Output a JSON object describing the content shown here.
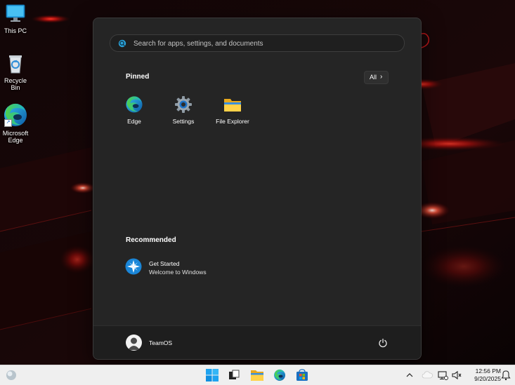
{
  "desktop": {
    "icons": [
      {
        "label": "This PC",
        "icon": "monitor-icon"
      },
      {
        "label": "Recycle Bin",
        "icon": "recycle-bin-icon"
      },
      {
        "label": "Microsoft Edge",
        "icon": "edge-icon"
      }
    ]
  },
  "start_menu": {
    "search": {
      "placeholder": "Search for apps, settings, and documents",
      "value": ""
    },
    "pinned": {
      "title": "Pinned",
      "all_label": "All",
      "items": [
        {
          "label": "Edge",
          "icon": "edge-icon"
        },
        {
          "label": "Settings",
          "icon": "settings-gear-icon"
        },
        {
          "label": "File Explorer",
          "icon": "folder-icon"
        }
      ]
    },
    "recommended": {
      "title": "Recommended",
      "items": [
        {
          "title": "Get Started",
          "subtitle": "Welcome to Windows",
          "icon": "get-started-icon"
        }
      ]
    },
    "user": {
      "name": "TeamOS"
    }
  },
  "taskbar": {
    "time": "12:56 PM",
    "date": "9/20/2025",
    "apps": [
      "widgets-icon",
      "start-icon",
      "task-view-icon",
      "file-explorer-icon",
      "edge-icon",
      "store-icon"
    ]
  },
  "colors": {
    "accent": "#0078d4",
    "start_bg": "#252525",
    "taskbar_bg": "#efefef"
  }
}
